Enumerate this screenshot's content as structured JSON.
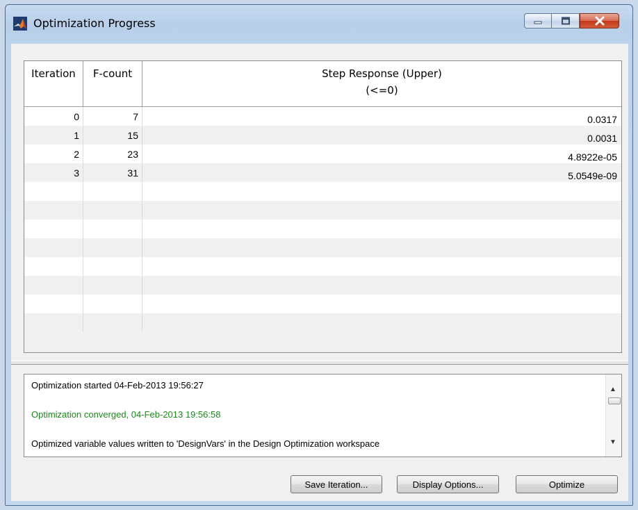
{
  "window": {
    "title": "Optimization Progress",
    "close_color": "#c2381a"
  },
  "table": {
    "headers": {
      "iteration": "Iteration",
      "fcount": "F-count",
      "response_title": "Step Response (Upper)",
      "response_sub": "(<=0)"
    },
    "rows": [
      {
        "iteration": "0",
        "fcount": "7",
        "value": "0.0317"
      },
      {
        "iteration": "1",
        "fcount": "15",
        "value": "0.0031"
      },
      {
        "iteration": "2",
        "fcount": "23",
        "value": "4.8922e-05"
      },
      {
        "iteration": "3",
        "fcount": "31",
        "value": "5.0549e-09"
      },
      {
        "iteration": "",
        "fcount": "",
        "value": ""
      },
      {
        "iteration": "",
        "fcount": "",
        "value": ""
      },
      {
        "iteration": "",
        "fcount": "",
        "value": ""
      },
      {
        "iteration": "",
        "fcount": "",
        "value": ""
      },
      {
        "iteration": "",
        "fcount": "",
        "value": ""
      },
      {
        "iteration": "",
        "fcount": "",
        "value": ""
      },
      {
        "iteration": "",
        "fcount": "",
        "value": ""
      },
      {
        "iteration": "",
        "fcount": "",
        "value": ""
      }
    ]
  },
  "log": {
    "lines": [
      "Optimization started 04-Feb-2013 19:56:27",
      "Optimization converged, 04-Feb-2013 19:56:58",
      "Optimized variable values written to 'DesignVars' in the Design Optimization workspace"
    ],
    "converged_color": "#1a8a1a"
  },
  "buttons": {
    "save": "Save Iteration...",
    "display": "Display Options...",
    "optimize": "Optimize"
  }
}
